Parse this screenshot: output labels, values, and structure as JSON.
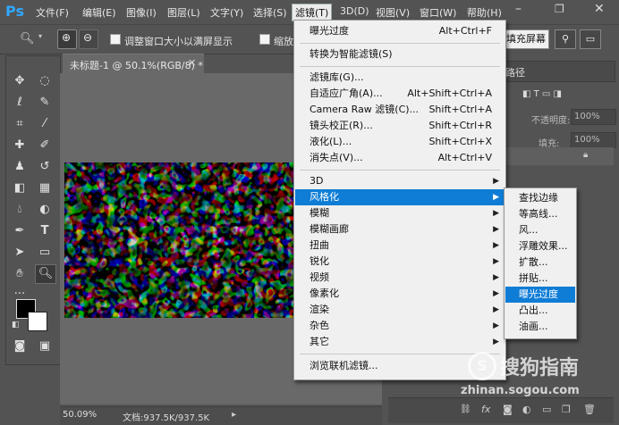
{
  "app": {
    "logo": "Ps"
  },
  "menubar": {
    "items": [
      "文件(F)",
      "编辑(E)",
      "图像(I)",
      "图层(L)",
      "文字(Y)",
      "选择(S)",
      "滤镜(T)",
      "3D(D)",
      "视图(V)",
      "窗口(W)",
      "帮助(H)"
    ],
    "active_index": 6
  },
  "options_bar": {
    "resize_window": "调整窗口大小以满屏显示",
    "zoom_all": "缩放所有",
    "fill_screen": "填充屏幕"
  },
  "document": {
    "tab_title": "未标题-1 @ 50.1%(RGB/8) *",
    "zoom": "50.09%",
    "doc_size": "文档:937.5K/937.5K"
  },
  "filter_menu": {
    "items": [
      {
        "label": "曝光过度",
        "shortcut": "Alt+Ctrl+F"
      },
      {
        "label": "转换为智能滤镜(S)",
        "shortcut": ""
      },
      {
        "label": "滤镜库(G)...",
        "shortcut": ""
      },
      {
        "label": "自适应广角(A)...",
        "shortcut": "Alt+Shift+Ctrl+A"
      },
      {
        "label": "Camera Raw 滤镜(C)...",
        "shortcut": "Shift+Ctrl+A"
      },
      {
        "label": "镜头校正(R)...",
        "shortcut": "Shift+Ctrl+R"
      },
      {
        "label": "液化(L)...",
        "shortcut": "Shift+Ctrl+X"
      },
      {
        "label": "消失点(V)...",
        "shortcut": "Alt+Ctrl+V"
      },
      {
        "label": "3D",
        "shortcut": ""
      },
      {
        "label": "风格化",
        "shortcut": ""
      },
      {
        "label": "模糊",
        "shortcut": ""
      },
      {
        "label": "模糊画廊",
        "shortcut": ""
      },
      {
        "label": "扭曲",
        "shortcut": ""
      },
      {
        "label": "锐化",
        "shortcut": ""
      },
      {
        "label": "视频",
        "shortcut": ""
      },
      {
        "label": "像素化",
        "shortcut": ""
      },
      {
        "label": "渲染",
        "shortcut": ""
      },
      {
        "label": "杂色",
        "shortcut": ""
      },
      {
        "label": "其它",
        "shortcut": ""
      },
      {
        "label": "浏览联机滤镜...",
        "shortcut": ""
      }
    ],
    "highlighted": "风格化"
  },
  "stylize_submenu": {
    "items": [
      "查找边缘",
      "等高线...",
      "风...",
      "浮雕效果...",
      "扩散...",
      "拼贴...",
      "曝光过度",
      "凸出...",
      "油画..."
    ],
    "highlighted": "曝光过度"
  },
  "layers_panel": {
    "tab": "路径",
    "opacity_label": "不透明度:",
    "opacity_value": "100%",
    "fill_label": "填充:",
    "fill_value": "100%"
  },
  "watermark": {
    "brand": "搜狗指南",
    "url": "zhinan.sogou.com"
  },
  "colors": {
    "accent": "#0f7dd6",
    "ps_blue": "#31a8ff"
  }
}
